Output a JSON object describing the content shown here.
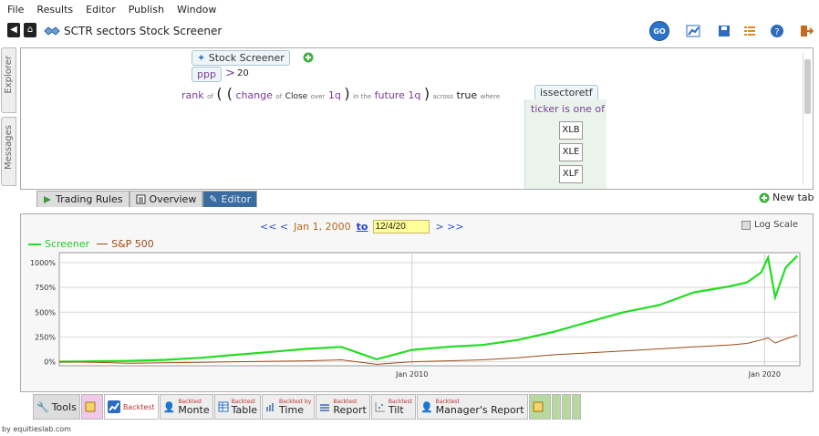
{
  "menu": [
    "File",
    "Results",
    "Editor",
    "Publish",
    "Window"
  ],
  "app_title": "SCTR sectors Stock Screener",
  "toolbar": {
    "go_label": "GO"
  },
  "side_tabs": {
    "explorer": "Explorer",
    "messages": "Messages"
  },
  "editor": {
    "screener_chip": "Stock Screener",
    "filter": {
      "field": "ppp",
      "op": ">",
      "value": "20"
    },
    "rank": {
      "rank": "rank",
      "of": "of",
      "open_paren": "( (",
      "change": "change",
      "of2": "of",
      "close": "Close",
      "over": "over",
      "period1": "1q",
      "close_paren1": ")",
      "in_the": "in the",
      "future": "future",
      "period2": "1q",
      "close_paren2": ")",
      "across": "across",
      "across_val": "true",
      "where": "where"
    },
    "sector_tab": "issectoretf",
    "sector_condition": "ticker is one of",
    "tickers": [
      "XLB",
      "XLE",
      "XLF"
    ]
  },
  "editor_tabs": [
    "Trading Rules",
    "Overview",
    "Editor"
  ],
  "new_tab": "New tab",
  "chart_nav": {
    "back": "<< <",
    "start": "Jan 1, 2000",
    "to": "to",
    "end": "12/4/20",
    "forward": "> >>"
  },
  "log_scale": "Log Scale",
  "chart_data": {
    "type": "line",
    "x": [
      2000,
      2001,
      2002,
      2003,
      2004,
      2005,
      2006,
      2007,
      2008,
      2009,
      2010,
      2011,
      2012,
      2013,
      2014,
      2015,
      2016,
      2017,
      2018,
      2019,
      2019.5,
      2019.9,
      2020.1,
      2020.3,
      2020.6,
      2020.93
    ],
    "series": [
      {
        "name": "Screener",
        "color": "#22dd22",
        "values": [
          0,
          5,
          10,
          20,
          40,
          70,
          100,
          130,
          150,
          25,
          120,
          150,
          170,
          220,
          300,
          400,
          500,
          570,
          700,
          760,
          800,
          900,
          1050,
          650,
          950,
          1070
        ]
      },
      {
        "name": "S&P 500",
        "color": "#a04a18",
        "values": [
          0,
          -5,
          -15,
          -10,
          -5,
          0,
          5,
          10,
          20,
          -25,
          0,
          10,
          20,
          40,
          70,
          90,
          110,
          130,
          150,
          170,
          185,
          220,
          240,
          190,
          230,
          270
        ]
      }
    ],
    "yticks": [
      "1000%",
      "750%",
      "500%",
      "250%",
      "0%"
    ],
    "ytick_values": [
      1000,
      750,
      500,
      250,
      0
    ],
    "xticks": [
      "Jan 2010",
      "Jan 2020"
    ],
    "xtick_values": [
      2010,
      2020
    ],
    "ylim": [
      -40,
      1100
    ],
    "xlim": [
      2000,
      2021
    ],
    "grid": true,
    "legend": "top-left"
  },
  "bottom_tabs": [
    {
      "small": "",
      "label": "Tools"
    },
    {
      "small": "",
      "label": ""
    },
    {
      "small": "",
      "label": "Backtest"
    },
    {
      "small": "Backtest",
      "label": "Monte"
    },
    {
      "small": "Backtest",
      "label": "Table"
    },
    {
      "small": "Backtest by",
      "label": "Time"
    },
    {
      "small": "Backtest",
      "label": "Report"
    },
    {
      "small": "Backtest",
      "label": "Tilt"
    },
    {
      "small": "Backtest",
      "label": "Manager's Report"
    }
  ],
  "footer": "by equitieslab.com"
}
